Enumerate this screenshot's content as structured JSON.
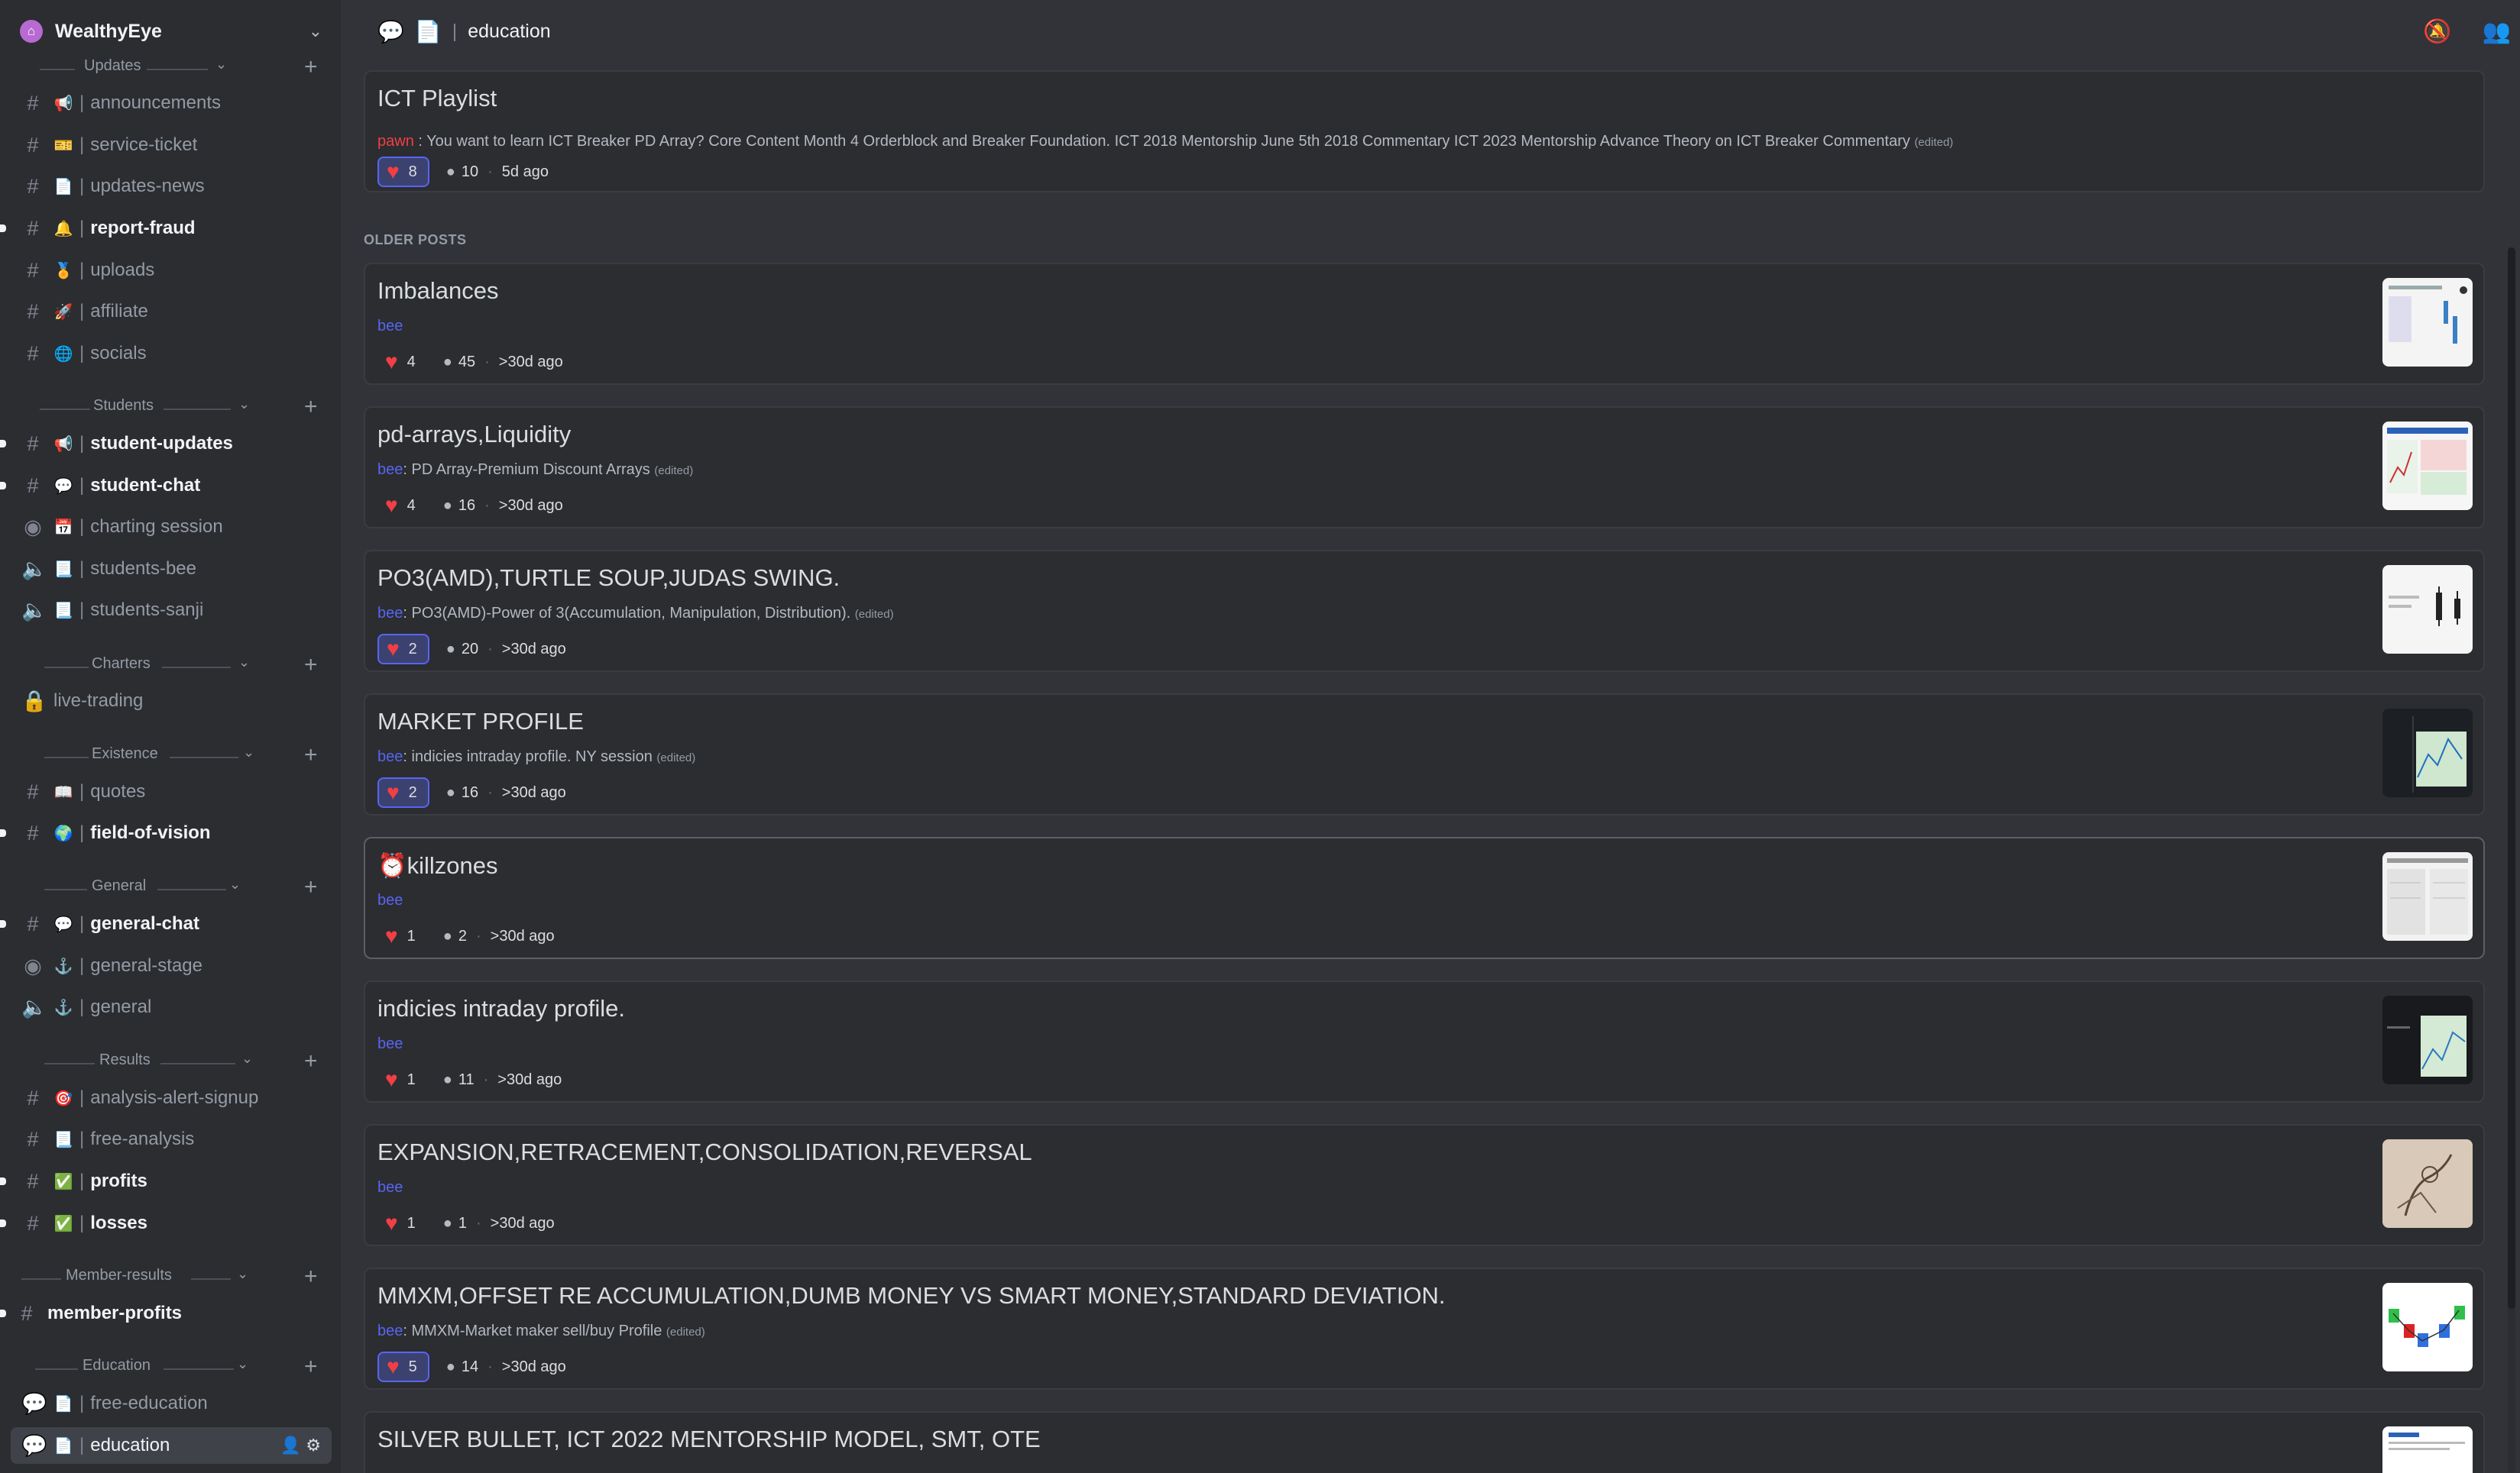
{
  "server": {
    "name": "WealthyEye"
  },
  "categories": [
    {
      "label": "Updates"
    },
    {
      "label": "Students"
    },
    {
      "label": "Charters"
    },
    {
      "label": "Existence"
    },
    {
      "label": "General"
    },
    {
      "label": "Results"
    },
    {
      "label": "Member-results"
    },
    {
      "label": "Education"
    }
  ],
  "channels": [
    {
      "name": "announcements",
      "emoji": "📢"
    },
    {
      "name": "service-ticket",
      "emoji": "🎫"
    },
    {
      "name": "updates-news",
      "emoji": "📄"
    },
    {
      "name": "report-fraud",
      "emoji": "🔔"
    },
    {
      "name": "uploads",
      "emoji": "🏅"
    },
    {
      "name": "affiliate",
      "emoji": "🚀"
    },
    {
      "name": "socials",
      "emoji": "🌐"
    },
    {
      "name": "student-updates",
      "emoji": "📢"
    },
    {
      "name": "student-chat",
      "emoji": "💬"
    },
    {
      "name": "charting session",
      "emoji": "📅"
    },
    {
      "name": "students-bee",
      "emoji": "📃"
    },
    {
      "name": "students-sanji",
      "emoji": "📃"
    },
    {
      "name": "live-trading",
      "emoji": ""
    },
    {
      "name": "quotes",
      "emoji": "📖"
    },
    {
      "name": "field-of-vision",
      "emoji": "🌍"
    },
    {
      "name": "general-chat",
      "emoji": "💬"
    },
    {
      "name": "general-stage",
      "emoji": "⚓"
    },
    {
      "name": "general",
      "emoji": "⚓"
    },
    {
      "name": "analysis-alert-signup",
      "emoji": "🎯"
    },
    {
      "name": "free-analysis",
      "emoji": "📃"
    },
    {
      "name": "profits",
      "emoji": "✅"
    },
    {
      "name": "losses",
      "emoji": "✅"
    },
    {
      "name": "member-profits",
      "emoji": ""
    },
    {
      "name": "free-education",
      "emoji": "📄"
    },
    {
      "name": "education",
      "emoji": "📄"
    }
  ],
  "topbar": {
    "channel": "education"
  },
  "feed": {
    "older_label": "OLDER POSTS",
    "edited_label": "(edited)",
    "posts": [
      {
        "title": "ICT Playlist",
        "author": "pawn",
        "snippet": "You want to learn ICT Breaker PD Array? Core Content Month 4 Orderblock and Breaker Foundation. ICT 2018 Mentorship June 5th 2018 Commentary ICT 2023 Mentorship Advance Theory on ICT Breaker Commentary",
        "likes": "8",
        "comments": "10",
        "age": "5d ago"
      },
      {
        "title": "Imbalances",
        "author": "bee",
        "snippet": "",
        "likes": "4",
        "comments": "45",
        "age": ">30d ago"
      },
      {
        "title": "pd-arrays,Liquidity",
        "author": "bee",
        "snippet": "PD Array-Premium Discount Arrays",
        "likes": "4",
        "comments": "16",
        "age": ">30d ago"
      },
      {
        "title": "PO3(AMD),TURTLE SOUP,JUDAS SWING.",
        "author": "bee",
        "snippet": "PO3(AMD)-Power of 3(Accumulation, Manipulation, Distribution).",
        "likes": "2",
        "comments": "20",
        "age": ">30d ago"
      },
      {
        "title": "MARKET PROFILE",
        "author": "bee",
        "snippet": "indicies intraday profile. NY session",
        "likes": "2",
        "comments": "16",
        "age": ">30d ago"
      },
      {
        "title": "⏰killzones",
        "author": "bee",
        "snippet": "",
        "likes": "1",
        "comments": "2",
        "age": ">30d ago"
      },
      {
        "title": "indicies intraday profile.",
        "author": "bee",
        "snippet": "",
        "likes": "1",
        "comments": "11",
        "age": ">30d ago"
      },
      {
        "title": "EXPANSION,RETRACEMENT,CONSOLIDATION,REVERSAL",
        "author": "bee",
        "snippet": "",
        "likes": "1",
        "comments": "1",
        "age": ">30d ago"
      },
      {
        "title": "MMXM,OFFSET RE ACCUMULATION,DUMB MONEY VS SMART MONEY,STANDARD DEVIATION.",
        "author": "bee",
        "snippet": "MMXM-Market maker sell/buy Profile",
        "likes": "5",
        "comments": "14",
        "age": ">30d ago"
      },
      {
        "title": "SILVER BULLET, ICT 2022 MENTORSHIP MODEL, SMT, OTE",
        "author": "",
        "snippet": "",
        "likes": "",
        "comments": "",
        "age": ""
      }
    ]
  },
  "icons": {
    "server": "house-icon",
    "hash": "hash-icon",
    "stage": "stage-icon",
    "voice": "speaker-icon",
    "lock": "lock-icon",
    "heart": "heart-icon",
    "comment": "speech-bubble-icon",
    "mute": "bell-muted-icon",
    "members": "members-icon"
  },
  "colors": {
    "accent": "#5865f2",
    "heart": "#f23f43",
    "background": "#313338",
    "sidebar": "#2b2d31"
  }
}
